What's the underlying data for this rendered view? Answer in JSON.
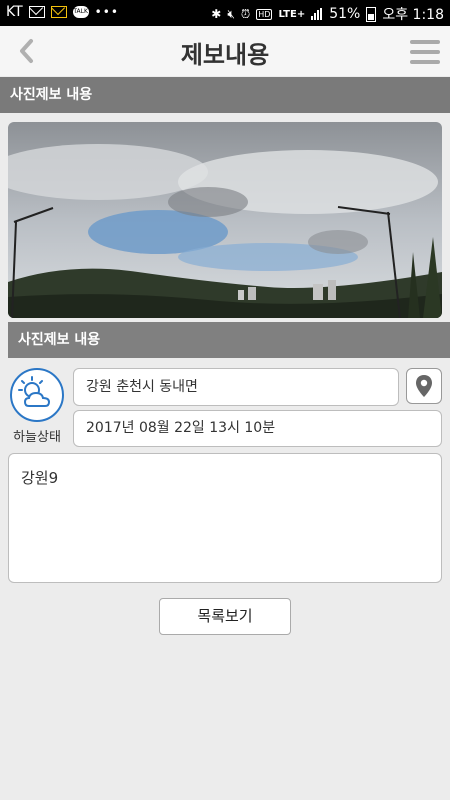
{
  "status_bar": {
    "carrier": "KT",
    "network": "LTE+",
    "battery": "51%",
    "time": "오후 1:18",
    "icons": [
      "mail-icon",
      "mail-icon",
      "talk-icon",
      "more-icon",
      "bluetooth-icon",
      "mute-icon",
      "alarm-icon",
      "hd-icon",
      "signal-icon",
      "battery-icon"
    ]
  },
  "header": {
    "title": "제보내용",
    "back_icon": "chevron-left-icon",
    "menu_icon": "hamburger-menu-icon"
  },
  "photo_section": {
    "label": "사진제보 내용"
  },
  "detail_section": {
    "label": "사진제보 내용",
    "sky_status_label": "하늘상태",
    "sky_icon": "partly-cloudy-icon",
    "location": "강원 춘천시 동내면",
    "location_icon": "map-pin-icon",
    "datetime": "2017년 08월 22일 13시 10분",
    "memo": "강원9"
  },
  "actions": {
    "list_button_label": "목록보기"
  },
  "colors": {
    "section_bar": "#7a7a7a",
    "weather_icon_blue": "#2b77c6",
    "background": "#ececec"
  }
}
